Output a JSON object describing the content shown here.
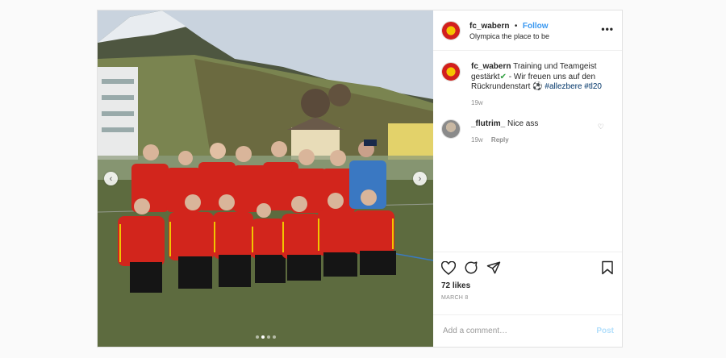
{
  "post": {
    "username": "fc_wabern",
    "follow_label": "Follow",
    "separator": "•",
    "location": "Olympica the place to be",
    "caption_text": "Training und Teamgeist gestärkt",
    "caption_check": "✔",
    "caption_rest": " - Wir freuen uns auf den Rückrundenstart ⚽ ",
    "hashtags": "#allezbere #tl20",
    "caption_time": "19w",
    "likes": "72 likes",
    "date": "MARCH 8"
  },
  "comments": [
    {
      "username": "_flutrim_",
      "text": "Nice ass",
      "time": "19w",
      "reply_label": "Reply"
    }
  ],
  "add_comment": {
    "placeholder": "Add a comment…",
    "post_label": "Post"
  },
  "carousel": {
    "slides": 4,
    "active_slide": 2
  },
  "colors": {
    "accent": "#3897f0",
    "jersey_red": "#d2251c",
    "jersey_yellow": "#f2c400"
  },
  "icons": [
    "more-icon",
    "heart-icon",
    "comment-icon",
    "share-icon",
    "bookmark-icon",
    "chevron-left-icon",
    "chevron-right-icon"
  ]
}
